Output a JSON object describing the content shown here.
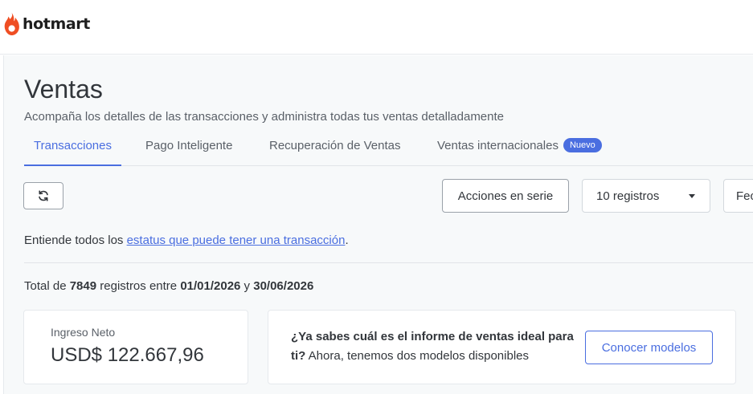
{
  "brand": {
    "name": "hotmart",
    "color": "#ef4e23"
  },
  "page": {
    "title": "Ventas",
    "subtitle": "Acompaña los detalles de las transacciones y administra todas tus ventas detalladamente"
  },
  "tabs": [
    {
      "label": "Transacciones",
      "active": true
    },
    {
      "label": "Pago Inteligente",
      "active": false
    },
    {
      "label": "Recuperación de Ventas",
      "active": false
    },
    {
      "label": "Ventas internacionales",
      "active": false,
      "badge": "Nuevo"
    }
  ],
  "toolbar": {
    "refresh_icon": "refresh-icon",
    "bulk_actions_label": "Acciones en serie",
    "records_select_value": "10 registros",
    "date_button_label": "Fecha"
  },
  "status_info": {
    "prefix": "Entiende todos los ",
    "link_text": "estatus que puede tener una transacción",
    "suffix": "."
  },
  "totals": {
    "prefix": "Total de ",
    "count": "7849",
    "middle": " registros entre ",
    "date_from": "01/01/2026",
    "joiner": " y ",
    "date_to": "30/06/2026"
  },
  "income": {
    "label": "Ingreso Neto",
    "value": "USD$ 122.667,96"
  },
  "promo": {
    "question": "¿Ya sabes cuál es el informe de ventas ideal para ti?",
    "text": " Ahora, tenemos dos modelos disponibles",
    "button_label": "Conocer modelos"
  },
  "colors": {
    "accent": "#4a6ee0",
    "text": "#32363b",
    "panel_bg": "#f7f9fa"
  }
}
